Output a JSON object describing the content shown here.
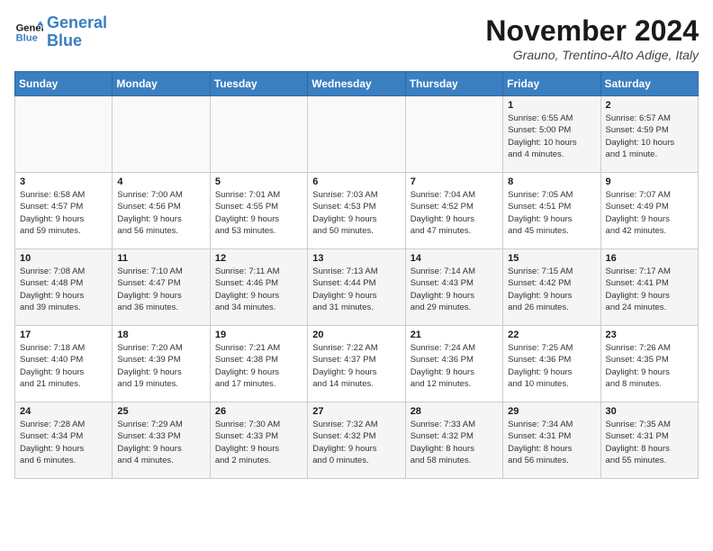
{
  "header": {
    "logo_line1": "General",
    "logo_line2": "Blue",
    "month_title": "November 2024",
    "location": "Grauno, Trentino-Alto Adige, Italy"
  },
  "days_of_week": [
    "Sunday",
    "Monday",
    "Tuesday",
    "Wednesday",
    "Thursday",
    "Friday",
    "Saturday"
  ],
  "weeks": [
    [
      {
        "day": "",
        "info": ""
      },
      {
        "day": "",
        "info": ""
      },
      {
        "day": "",
        "info": ""
      },
      {
        "day": "",
        "info": ""
      },
      {
        "day": "",
        "info": ""
      },
      {
        "day": "1",
        "info": "Sunrise: 6:55 AM\nSunset: 5:00 PM\nDaylight: 10 hours\nand 4 minutes."
      },
      {
        "day": "2",
        "info": "Sunrise: 6:57 AM\nSunset: 4:59 PM\nDaylight: 10 hours\nand 1 minute."
      }
    ],
    [
      {
        "day": "3",
        "info": "Sunrise: 6:58 AM\nSunset: 4:57 PM\nDaylight: 9 hours\nand 59 minutes."
      },
      {
        "day": "4",
        "info": "Sunrise: 7:00 AM\nSunset: 4:56 PM\nDaylight: 9 hours\nand 56 minutes."
      },
      {
        "day": "5",
        "info": "Sunrise: 7:01 AM\nSunset: 4:55 PM\nDaylight: 9 hours\nand 53 minutes."
      },
      {
        "day": "6",
        "info": "Sunrise: 7:03 AM\nSunset: 4:53 PM\nDaylight: 9 hours\nand 50 minutes."
      },
      {
        "day": "7",
        "info": "Sunrise: 7:04 AM\nSunset: 4:52 PM\nDaylight: 9 hours\nand 47 minutes."
      },
      {
        "day": "8",
        "info": "Sunrise: 7:05 AM\nSunset: 4:51 PM\nDaylight: 9 hours\nand 45 minutes."
      },
      {
        "day": "9",
        "info": "Sunrise: 7:07 AM\nSunset: 4:49 PM\nDaylight: 9 hours\nand 42 minutes."
      }
    ],
    [
      {
        "day": "10",
        "info": "Sunrise: 7:08 AM\nSunset: 4:48 PM\nDaylight: 9 hours\nand 39 minutes."
      },
      {
        "day": "11",
        "info": "Sunrise: 7:10 AM\nSunset: 4:47 PM\nDaylight: 9 hours\nand 36 minutes."
      },
      {
        "day": "12",
        "info": "Sunrise: 7:11 AM\nSunset: 4:46 PM\nDaylight: 9 hours\nand 34 minutes."
      },
      {
        "day": "13",
        "info": "Sunrise: 7:13 AM\nSunset: 4:44 PM\nDaylight: 9 hours\nand 31 minutes."
      },
      {
        "day": "14",
        "info": "Sunrise: 7:14 AM\nSunset: 4:43 PM\nDaylight: 9 hours\nand 29 minutes."
      },
      {
        "day": "15",
        "info": "Sunrise: 7:15 AM\nSunset: 4:42 PM\nDaylight: 9 hours\nand 26 minutes."
      },
      {
        "day": "16",
        "info": "Sunrise: 7:17 AM\nSunset: 4:41 PM\nDaylight: 9 hours\nand 24 minutes."
      }
    ],
    [
      {
        "day": "17",
        "info": "Sunrise: 7:18 AM\nSunset: 4:40 PM\nDaylight: 9 hours\nand 21 minutes."
      },
      {
        "day": "18",
        "info": "Sunrise: 7:20 AM\nSunset: 4:39 PM\nDaylight: 9 hours\nand 19 minutes."
      },
      {
        "day": "19",
        "info": "Sunrise: 7:21 AM\nSunset: 4:38 PM\nDaylight: 9 hours\nand 17 minutes."
      },
      {
        "day": "20",
        "info": "Sunrise: 7:22 AM\nSunset: 4:37 PM\nDaylight: 9 hours\nand 14 minutes."
      },
      {
        "day": "21",
        "info": "Sunrise: 7:24 AM\nSunset: 4:36 PM\nDaylight: 9 hours\nand 12 minutes."
      },
      {
        "day": "22",
        "info": "Sunrise: 7:25 AM\nSunset: 4:36 PM\nDaylight: 9 hours\nand 10 minutes."
      },
      {
        "day": "23",
        "info": "Sunrise: 7:26 AM\nSunset: 4:35 PM\nDaylight: 9 hours\nand 8 minutes."
      }
    ],
    [
      {
        "day": "24",
        "info": "Sunrise: 7:28 AM\nSunset: 4:34 PM\nDaylight: 9 hours\nand 6 minutes."
      },
      {
        "day": "25",
        "info": "Sunrise: 7:29 AM\nSunset: 4:33 PM\nDaylight: 9 hours\nand 4 minutes."
      },
      {
        "day": "26",
        "info": "Sunrise: 7:30 AM\nSunset: 4:33 PM\nDaylight: 9 hours\nand 2 minutes."
      },
      {
        "day": "27",
        "info": "Sunrise: 7:32 AM\nSunset: 4:32 PM\nDaylight: 9 hours\nand 0 minutes."
      },
      {
        "day": "28",
        "info": "Sunrise: 7:33 AM\nSunset: 4:32 PM\nDaylight: 8 hours\nand 58 minutes."
      },
      {
        "day": "29",
        "info": "Sunrise: 7:34 AM\nSunset: 4:31 PM\nDaylight: 8 hours\nand 56 minutes."
      },
      {
        "day": "30",
        "info": "Sunrise: 7:35 AM\nSunset: 4:31 PM\nDaylight: 8 hours\nand 55 minutes."
      }
    ]
  ]
}
